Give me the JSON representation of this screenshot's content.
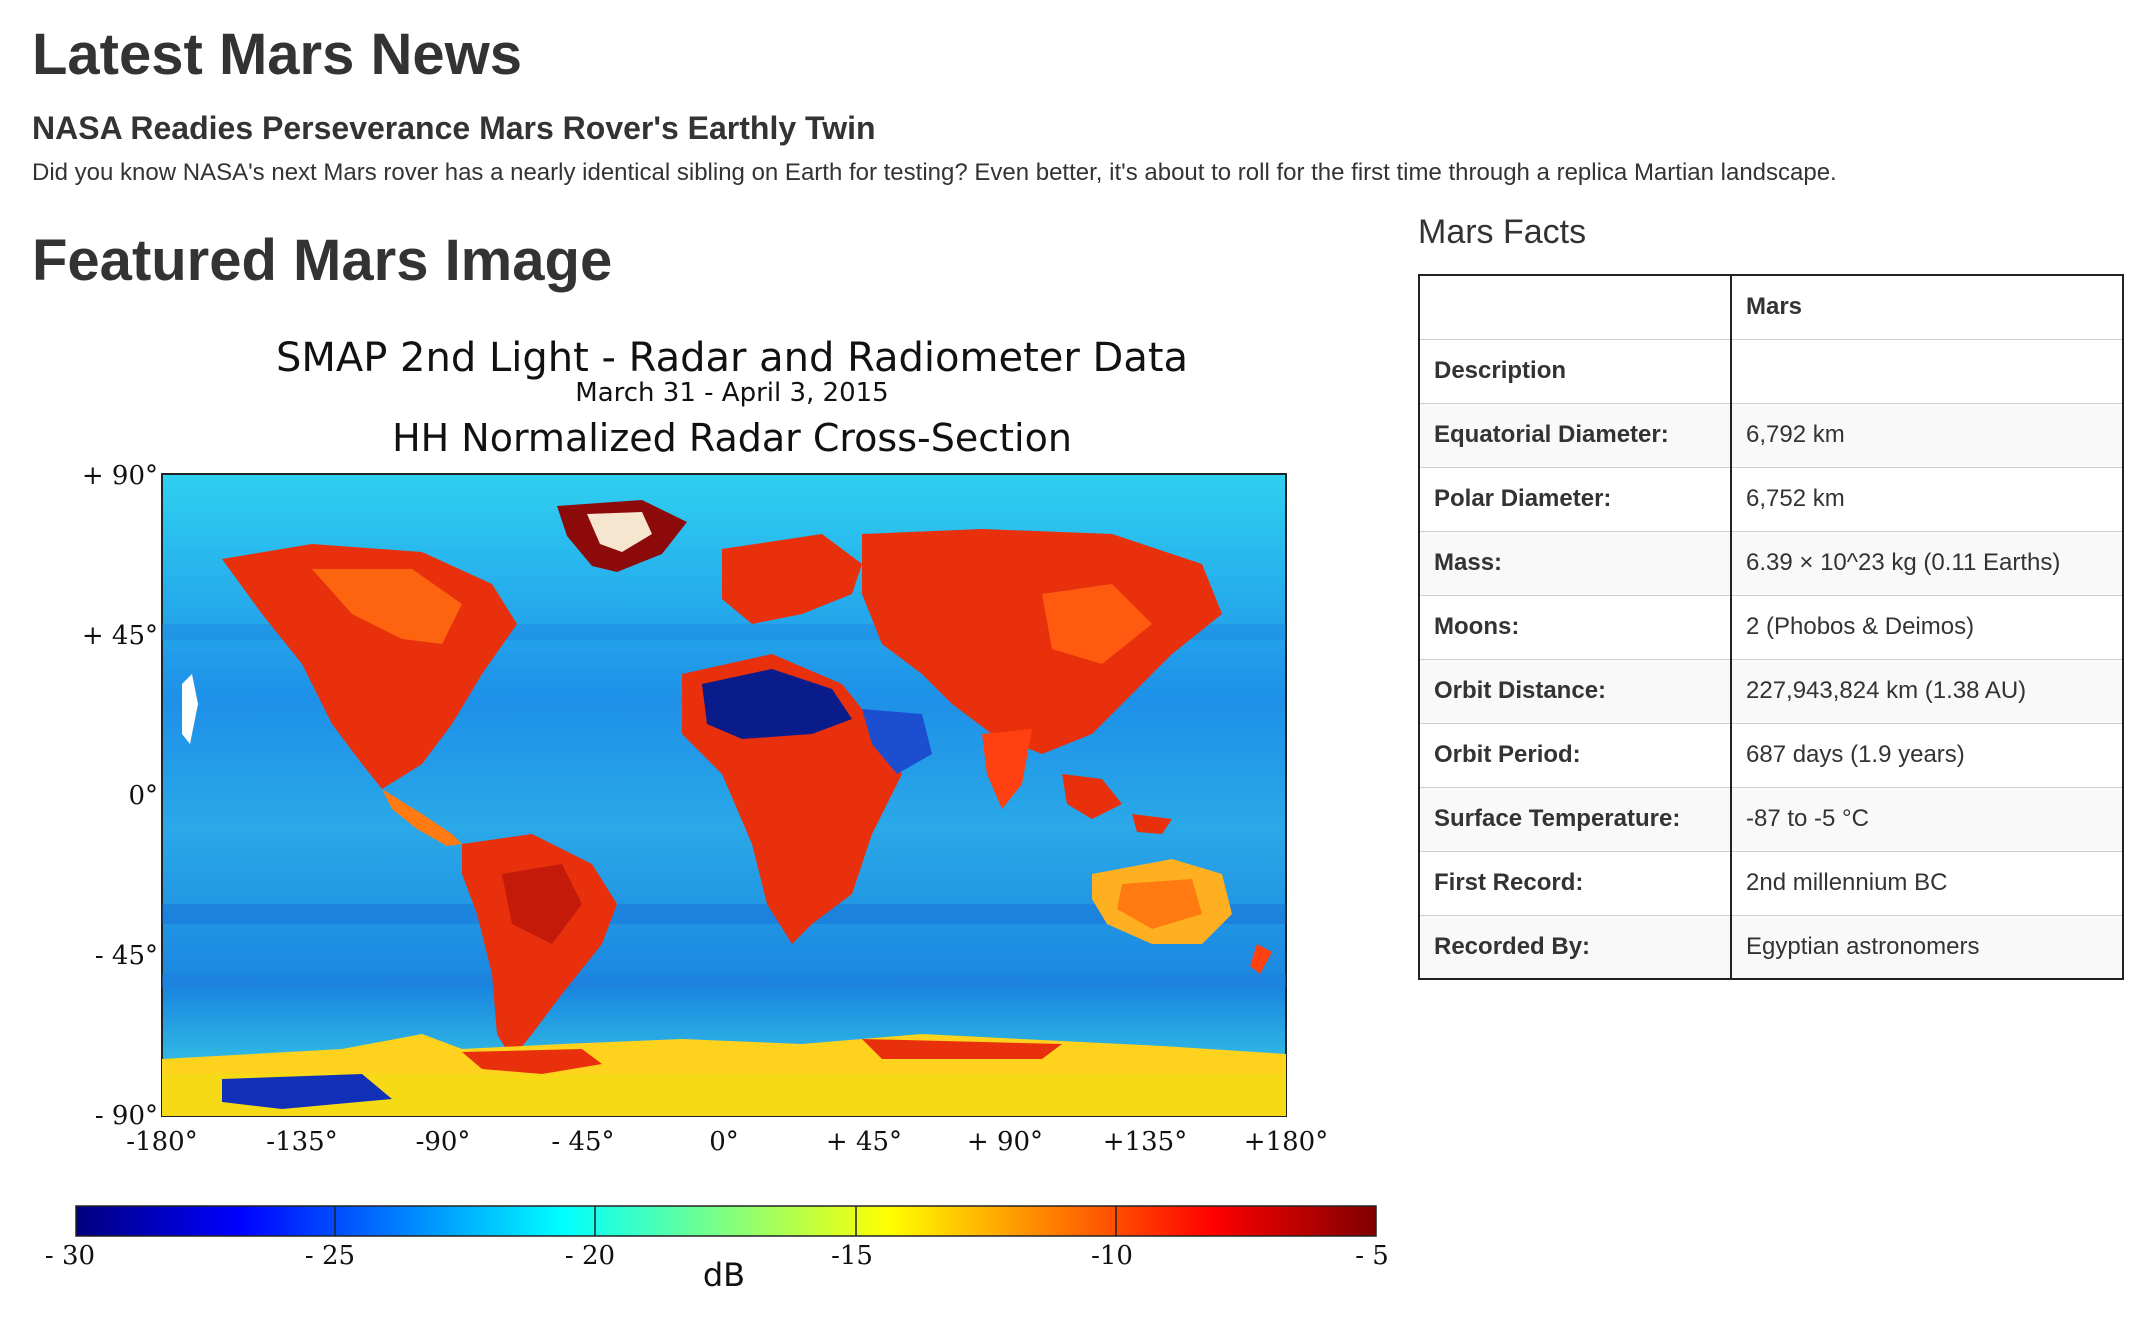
{
  "news": {
    "heading": "Latest Mars News",
    "title": "NASA Readies Perseverance Mars Rover's Earthly Twin",
    "teaser": "Did you know NASA's next Mars rover has a nearly identical sibling on Earth for testing? Even better, it's about to roll for the first time through a replica Martian landscape."
  },
  "featured": {
    "heading": "Featured Mars Image",
    "figure": {
      "title": "SMAP 2nd Light - Radar and Radiometer Data",
      "date": "March 31 - April 3, 2015",
      "subtitle": "HH Normalized Radar Cross-Section",
      "lat_ticks": [
        "+ 90°",
        "+ 45°",
        "0°",
        "- 45°",
        "- 90°"
      ],
      "lon_ticks": [
        "-180°",
        "-135°",
        "-90°",
        "- 45°",
        "0°",
        "+ 45°",
        "+ 90°",
        "+135°",
        "+180°"
      ],
      "colorbar_ticks": [
        "- 30",
        "- 25",
        "- 20",
        "-15",
        "-10",
        "- 5"
      ],
      "colorbar_label": "dB",
      "colors": {
        "ocean": "#2aa8e8",
        "land_hot": "#e8300c",
        "land_dark": "#8c0a0a",
        "desert": "#0a1c8c",
        "ice": "#ffd21e"
      }
    }
  },
  "facts": {
    "heading": "Mars Facts",
    "column_header": "Mars",
    "rows": [
      {
        "key": "Description",
        "value": ""
      },
      {
        "key": "Equatorial Diameter:",
        "value": "6,792 km"
      },
      {
        "key": "Polar Diameter:",
        "value": "6,752 km"
      },
      {
        "key": "Mass:",
        "value": "6.39 × 10^23 kg (0.11 Earths)"
      },
      {
        "key": "Moons:",
        "value": "2 (Phobos & Deimos)"
      },
      {
        "key": "Orbit Distance:",
        "value": "227,943,824 km (1.38 AU)"
      },
      {
        "key": "Orbit Period:",
        "value": "687 days (1.9 years)"
      },
      {
        "key": "Surface Temperature:",
        "value": "-87 to -5 °C"
      },
      {
        "key": "First Record:",
        "value": "2nd millennium BC"
      },
      {
        "key": "Recorded By:",
        "value": "Egyptian astronomers"
      }
    ]
  }
}
